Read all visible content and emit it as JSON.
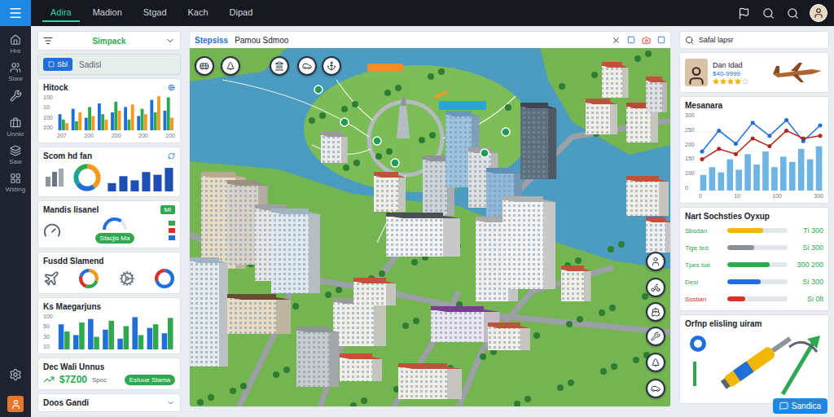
{
  "top_bar": {
    "tabs": [
      {
        "label": "Adira",
        "selected": true
      },
      {
        "label": "Madion",
        "selected": false
      },
      {
        "label": "Stgad",
        "selected": false
      },
      {
        "label": "Kach",
        "selected": false
      },
      {
        "label": "Dipad",
        "selected": false
      }
    ]
  },
  "rail": {
    "items": [
      {
        "label": "Hre"
      },
      {
        "label": "Slaw"
      },
      {
        "label": "Unnkr"
      },
      {
        "label": "Saw"
      },
      {
        "label": "Wsting"
      }
    ]
  },
  "left_panel": {
    "select": {
      "value": "Simpack"
    },
    "badge": {
      "label": "Sbl",
      "text": "Sadisl"
    },
    "hitock": {
      "title": "Hitock",
      "y_ticks": [
        "100",
        "10",
        "100",
        "100"
      ],
      "x_ticks": [
        "207",
        "200",
        "200",
        "200",
        "200"
      ],
      "series": [
        {
          "color": "#1e6fd9",
          "values": [
            45,
            60,
            35,
            75,
            50,
            65,
            40,
            85,
            55
          ]
        },
        {
          "color": "#2fa84f",
          "values": [
            30,
            25,
            65,
            45,
            80,
            30,
            60,
            50,
            92
          ]
        },
        {
          "color": "#f29a1f",
          "values": [
            20,
            50,
            40,
            30,
            55,
            72,
            45,
            95,
            35
          ]
        }
      ]
    },
    "scom": {
      "title": "Scom hd fan",
      "donut": [
        {
          "value": 40,
          "color": "#f29a1f"
        },
        {
          "value": 25,
          "color": "#1e6fd9"
        },
        {
          "value": 20,
          "color": "#19a0a0"
        },
        {
          "value": 15,
          "color": "#2fa84f"
        }
      ],
      "bars": {
        "color": "#1e4fb3",
        "values": [
          30,
          55,
          40,
          70,
          60,
          85
        ]
      }
    },
    "mandis": {
      "title": "Mandis lisanel",
      "tag": "Mi",
      "gauge": {
        "level": 0.7,
        "color": "#1e6fd9"
      },
      "button": "Sfacjis Ma",
      "legend": [
        {
          "color": "#2fa84f"
        },
        {
          "color": "#d93025"
        },
        {
          "color": "#1e6fd9"
        }
      ]
    },
    "fusdd": {
      "title": "Fusdd Slamend",
      "donuts": [
        [
          {
            "value": 30,
            "color": "#f29a1f"
          },
          {
            "value": 25,
            "color": "#2fa84f"
          },
          {
            "value": 25,
            "color": "#d93025"
          },
          {
            "value": 20,
            "color": "#1e6fd9"
          }
        ],
        [
          {
            "value": 70,
            "color": "#1e6fd9"
          },
          {
            "value": 30,
            "color": "#d93025"
          }
        ]
      ]
    },
    "ks": {
      "title": "Ks Maegarjuns",
      "y_ticks": [
        "100",
        "50",
        "30",
        "10"
      ],
      "series": [
        {
          "color": "#1e6fd9",
          "values": [
            70,
            40,
            85,
            55,
            30,
            90,
            60,
            45
          ]
        },
        {
          "color": "#2fa84f",
          "values": [
            50,
            75,
            35,
            80,
            65,
            40,
            70,
            88
          ]
        }
      ]
    },
    "dec": {
      "title": "Dec Wali Unnus",
      "amount": "$7Z00",
      "unit": "Spoc",
      "button": "Estuue Stama"
    },
    "footer": {
      "label": "Doos Gandi"
    }
  },
  "map": {
    "title": "Stepsiss",
    "subtitle": "Pamou Sdmoo",
    "tags": [
      {
        "color": "#f28c28"
      },
      {
        "color": "#29a3d9"
      }
    ]
  },
  "right_panel": {
    "search": {
      "placeholder": "Safal lapsr"
    },
    "profile": {
      "name": "Dan Idad",
      "price": "$40-9999",
      "stars": 4
    },
    "mesanara": {
      "title": "Mesanara",
      "y_ticks": [
        "300",
        "250",
        "200",
        "150",
        "100",
        "0"
      ],
      "x_ticks": [
        "0",
        "10",
        "100",
        "300"
      ],
      "series": [
        {
          "kind": "bar",
          "color": "#4aa3df",
          "values": [
            60,
            90,
            70,
            120,
            80,
            140,
            100,
            150,
            90,
            130,
            110,
            160,
            120,
            170
          ]
        },
        {
          "kind": "line",
          "color": "#1e6fd9",
          "values": [
            150,
            230,
            180,
            260,
            210,
            270,
            190,
            250
          ]
        },
        {
          "kind": "line",
          "color": "#b3261e",
          "values": [
            120,
            160,
            140,
            200,
            170,
            230,
            200,
            210
          ]
        }
      ]
    },
    "stats": {
      "title": "Nart Sochsties Oyxup",
      "rows": [
        {
          "label": "Sbsdan",
          "value": "Ti 300",
          "level": 0.6,
          "color": "#f2b705"
        },
        {
          "label": "Tige ted",
          "value": "Si 300",
          "level": 0.45,
          "color": "#8a9099"
        },
        {
          "label": "Tpes bai",
          "value": "300 200",
          "level": 0.7,
          "color": "#2fa84f"
        },
        {
          "label": "Desi",
          "value": "Si 300",
          "level": 0.55,
          "color": "#1e6fd9"
        },
        {
          "label": "Ssstian",
          "value": "Si 0lt",
          "level": 0.3,
          "color": "#d93025"
        }
      ]
    },
    "tools": {
      "title": "Orfnp elisling uiram"
    },
    "chat_button": "Sandica"
  }
}
